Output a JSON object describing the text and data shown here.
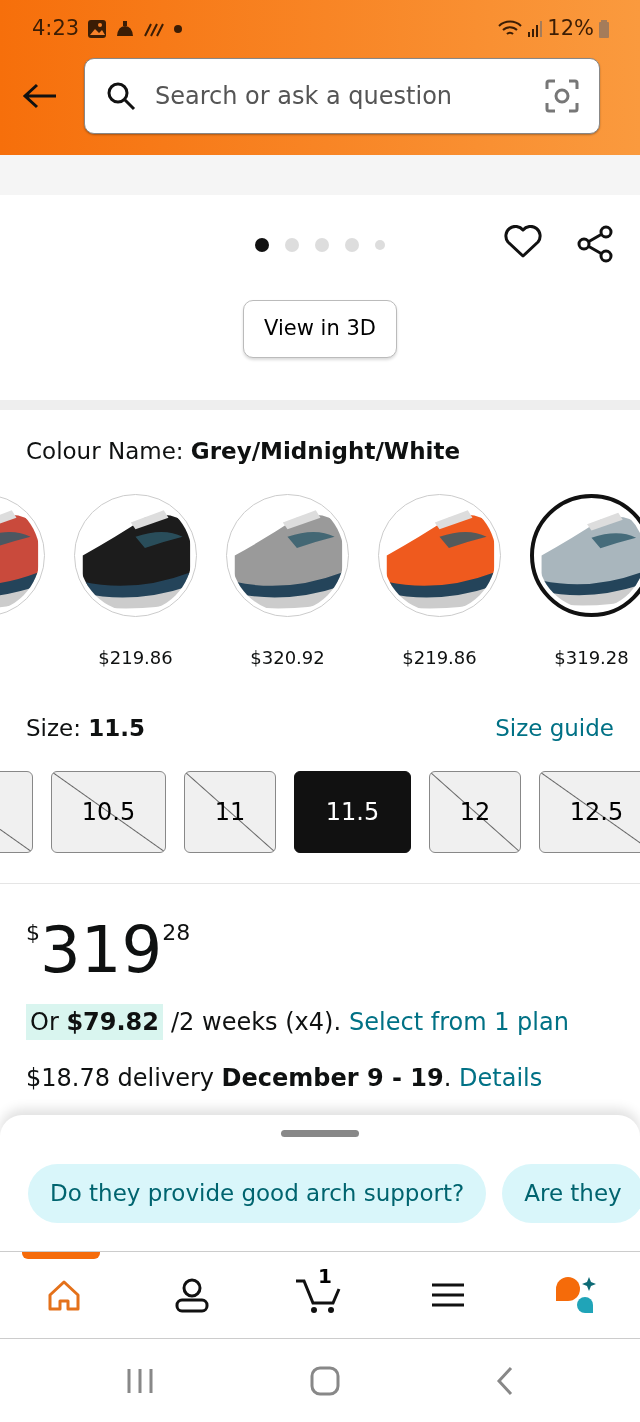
{
  "status_bar": {
    "time": "4:23",
    "battery": "12%"
  },
  "search": {
    "placeholder": "Search or ask a question"
  },
  "gallery": {
    "dots": [
      {
        "selected": true
      },
      {
        "selected": false
      },
      {
        "selected": false
      },
      {
        "selected": false
      },
      {
        "selected": false
      }
    ],
    "view_3d": "View in 3D"
  },
  "colour": {
    "label": "Colour Name: ",
    "value": "Grey/Midnight/White"
  },
  "swatches": [
    {
      "color": "#c94a3c",
      "selected": false
    },
    {
      "color": "#1c1c1c",
      "price": "$219.86",
      "selected": false
    },
    {
      "color": "#9a9a9a",
      "price": "$320.92",
      "selected": false
    },
    {
      "color": "#ef5a1e",
      "price": "$219.86",
      "selected": false
    },
    {
      "color": "#a9b6bd",
      "price": "$319.28",
      "selected": true
    }
  ],
  "size": {
    "label": "Size: ",
    "value": "11.5",
    "guide": "Size guide"
  },
  "sizes": [
    {
      "available": false,
      "selected": false
    },
    {
      "label": "10.5",
      "available": false,
      "selected": false
    },
    {
      "label": "11",
      "available": false,
      "selected": false
    },
    {
      "label": "11.5",
      "available": true,
      "selected": true
    },
    {
      "label": "12",
      "available": false,
      "selected": false
    },
    {
      "label": "12.5",
      "available": false,
      "selected": false
    }
  ],
  "price": {
    "currency": "$",
    "whole": "319",
    "fraction": "28"
  },
  "installment": {
    "amount": "Or **$79.82**",
    "period": "/2 weeks (x4).",
    "plan": "Select from 1 plan"
  },
  "delivery": {
    "text": "$18.78 delivery **December 9 - 19**.",
    "link": "Details"
  },
  "questions": [
    "Do they provide good arch support?",
    "Are they"
  ],
  "tabs": [
    {
      "kind": "home",
      "selected": true
    },
    {
      "kind": "account",
      "selected": false
    },
    {
      "kind": "cart",
      "count": "1",
      "selected": false
    },
    {
      "kind": "menu",
      "selected": false
    },
    {
      "kind": "assistant",
      "selected": false
    }
  ]
}
